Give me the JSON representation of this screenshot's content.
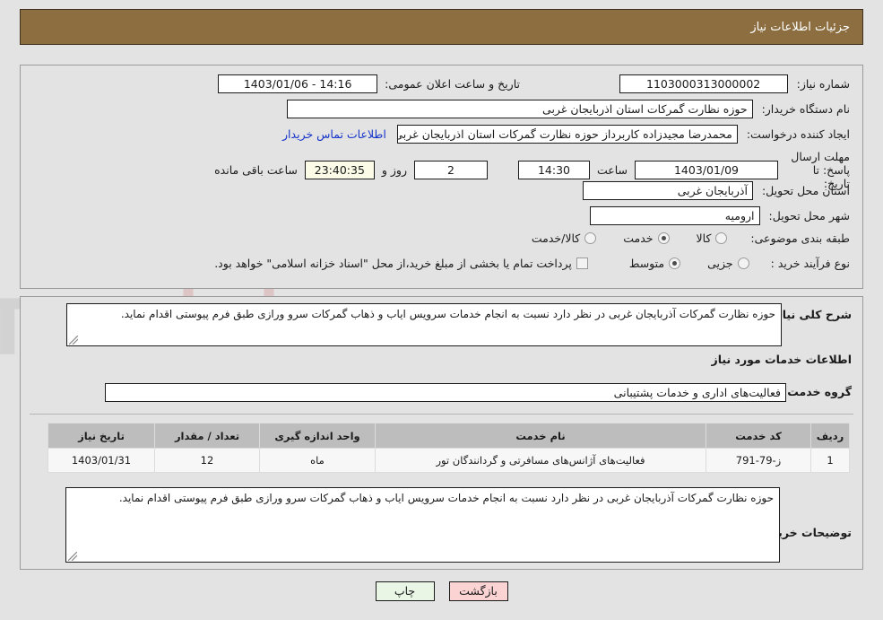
{
  "header": {
    "title": "جزئیات اطلاعات نیاز"
  },
  "top": {
    "need_number_label": "شماره نیاز:",
    "need_number_value": "1103000313000002",
    "announce_label": "تاریخ و ساعت اعلان عمومی:",
    "announce_value": "14:16 - 1403/01/06",
    "buyer_org_label": "نام دستگاه خریدار:",
    "buyer_org_value": "حوزه نظارت گمرکات استان اذربایجان غربی",
    "creator_label": "ایجاد کننده درخواست:",
    "creator_value": "محمدرضا مجیدزاده کاربرداز حوزه نظارت گمرکات استان اذربایجان غربی",
    "contact_link": "اطلاعات تماس خریدار",
    "deadline_label": "مهلت ارسال پاسخ: تا تاریخ:",
    "deadline_date": "1403/01/09",
    "hour_label": "ساعت",
    "deadline_time": "14:30",
    "days_value": "2",
    "days_label": "روز و",
    "countdown_value": "23:40:35",
    "remaining_label": "ساعت باقی مانده",
    "province_label": "استان محل تحویل:",
    "province_value": "آذربایجان غربی",
    "city_label": "شهر محل تحویل:",
    "city_value": "ارومیه",
    "category_label": "طبقه بندی موضوعی:",
    "category_options": [
      {
        "label": "کالا",
        "selected": false
      },
      {
        "label": "خدمت",
        "selected": true
      },
      {
        "label": "کالا/خدمت",
        "selected": false
      }
    ],
    "process_label": "نوع فرآیند خرید :",
    "process_options": [
      {
        "label": "جزیی",
        "selected": false
      },
      {
        "label": "متوسط",
        "selected": true
      }
    ],
    "treasury_checked": false,
    "treasury_text": "پرداخت تمام یا بخشی از مبلغ خرید،از محل \"اسناد خزانه اسلامی\" خواهد بود."
  },
  "bottom": {
    "summary_label": "شرح کلی نیاز:",
    "summary_value": "حوزه نظارت گمرکات آذربایجان غربی در نظر دارد نسبت به انجام خدمات سرویس ایاب و ذهاب گمرکات سرو ورازی طبق فرم پیوستی اقدام نماید.",
    "section_title": "اطلاعات خدمات مورد نیاز",
    "service_group_label": "گروه خدمت:",
    "service_group_value": "فعالیت‌های اداری و خدمات پشتیبانی",
    "table": {
      "headers": [
        "ردیف",
        "کد خدمت",
        "نام خدمت",
        "واحد اندازه گیری",
        "تعداد / مقدار",
        "تاریخ نیاز"
      ],
      "rows": [
        [
          "1",
          "ز-79-791",
          "فعالیت‌های آژانس‌های مسافرتی و گردانندگان تور",
          "ماه",
          "12",
          "1403/01/31"
        ]
      ]
    },
    "notes_label": "توضیحات خریدار:",
    "notes_value": "حوزه نظارت گمرکات آذربایجان غربی در نظر دارد نسبت به انجام خدمات سرویس ایاب و ذهاب گمرکات سرو ورازی طبق فرم پیوستی اقدام نماید."
  },
  "buttons": {
    "print": "چاپ",
    "back": "بازگشت"
  },
  "colors": {
    "header_bar": "#8d6e41",
    "link": "#1433c9",
    "countdown_bg": "#fbfbe7",
    "print_btn_bg": "#e9f6e6",
    "back_btn_bg": "#fbd3d3",
    "table_header_bg": "#bdbdbd"
  }
}
